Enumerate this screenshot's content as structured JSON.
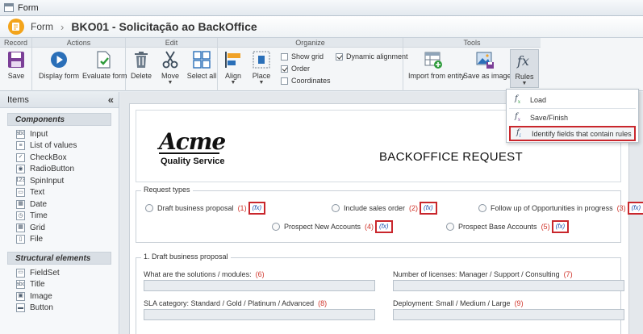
{
  "window": {
    "title": "Form"
  },
  "header": {
    "breadcrumb": "Form",
    "doc_title": "BKO01 - Solicitação ao BackOffice"
  },
  "ribbon": {
    "groups": {
      "record": "Record",
      "actions": "Actions",
      "edit": "Edit",
      "organize": "Organize",
      "tools": "Tools"
    },
    "save": "Save",
    "display_form": "Display form",
    "evaluate_form": "Evaluate form",
    "delete": "Delete",
    "move": "Move",
    "select_all": "Select all",
    "align": "Align",
    "place": "Place",
    "show_grid": "Show grid",
    "order": "Order",
    "coordinates": "Coordinates",
    "dynamic_alignment": "Dynamic alignment",
    "import_from_entity": "Import from entity",
    "save_as_image": "Save as image",
    "rules": "Rules",
    "checks": {
      "show_grid": false,
      "order": true,
      "coordinates": false,
      "dynamic_alignment": true
    }
  },
  "rules_menu": {
    "items": [
      "Load",
      "Save/Finish",
      "Identify fields that contain rules"
    ]
  },
  "sidebar": {
    "title": "Items",
    "components_title": "Components",
    "components": [
      {
        "label": "Input",
        "icon": "abc"
      },
      {
        "label": "List of values",
        "icon": "≡"
      },
      {
        "label": "CheckBox",
        "icon": "✓"
      },
      {
        "label": "RadioButton",
        "icon": "◉"
      },
      {
        "label": "SpinInput",
        "icon": "123"
      },
      {
        "label": "Text",
        "icon": "▭"
      },
      {
        "label": "Date",
        "icon": "▦"
      },
      {
        "label": "Time",
        "icon": "◷"
      },
      {
        "label": "Grid",
        "icon": "▦"
      },
      {
        "label": "File",
        "icon": "▯"
      }
    ],
    "structural_title": "Structural elements",
    "structural": [
      {
        "label": "FieldSet",
        "icon": "▭"
      },
      {
        "label": "Title",
        "icon": "abc"
      },
      {
        "label": "Image",
        "icon": "▣"
      },
      {
        "label": "Button",
        "icon": "▬"
      }
    ]
  },
  "form": {
    "logo_main": "Acme",
    "logo_sub": "Quality Service",
    "title": "BACKOFFICE REQUEST",
    "request_types": {
      "legend": "Request types",
      "options": [
        {
          "label": "Draft business proposal",
          "num": "(1)"
        },
        {
          "label": "Include sales order",
          "num": "(2)"
        },
        {
          "label": "Follow up of Opportunities in progress",
          "num": "(3)"
        },
        {
          "label": "Prospect New Accounts",
          "num": "(4)"
        },
        {
          "label": "Prospect Base Accounts",
          "num": "(5)"
        }
      ],
      "fx_label": "(fx)"
    },
    "draft": {
      "legend": "1. Draft business proposal",
      "fields": [
        {
          "label": "What are the solutions / modules:",
          "num": "(6)"
        },
        {
          "label": "Number of licenses: Manager / Support / Consulting",
          "num": "(7)"
        },
        {
          "label": "SLA category: Standard / Gold / Platinum / Advanced",
          "num": "(8)"
        },
        {
          "label": "Deployment: Small / Medium / Large",
          "num": "(9)"
        }
      ]
    }
  }
}
